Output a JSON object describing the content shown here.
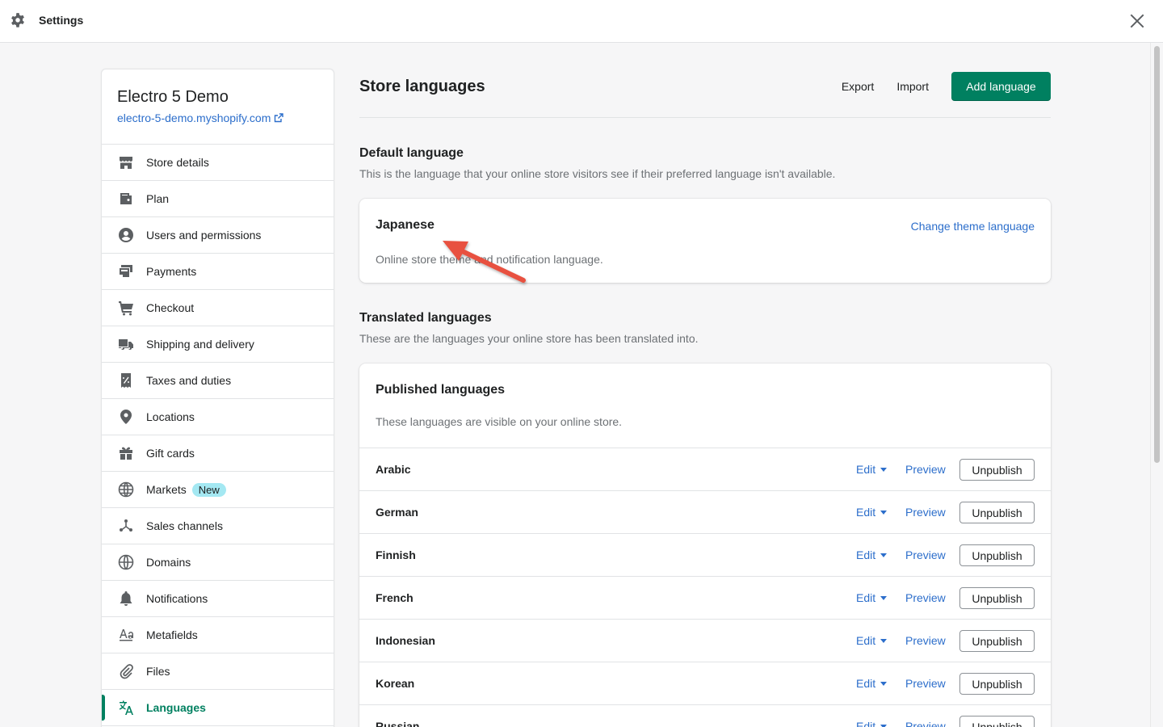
{
  "topbar": {
    "title": "Settings"
  },
  "store": {
    "name": "Electro 5 Demo",
    "url": "electro-5-demo.myshopify.com"
  },
  "sidebar": {
    "items": [
      {
        "label": "Store details",
        "icon": "store-icon"
      },
      {
        "label": "Plan",
        "icon": "wallet-icon"
      },
      {
        "label": "Users and permissions",
        "icon": "user-icon"
      },
      {
        "label": "Payments",
        "icon": "payment-icon"
      },
      {
        "label": "Checkout",
        "icon": "cart-icon"
      },
      {
        "label": "Shipping and delivery",
        "icon": "truck-icon"
      },
      {
        "label": "Taxes and duties",
        "icon": "tax-icon"
      },
      {
        "label": "Locations",
        "icon": "location-icon"
      },
      {
        "label": "Gift cards",
        "icon": "gift-icon"
      },
      {
        "label": "Markets",
        "icon": "globe-icon",
        "badge": "New"
      },
      {
        "label": "Sales channels",
        "icon": "channels-icon"
      },
      {
        "label": "Domains",
        "icon": "domain-icon"
      },
      {
        "label": "Notifications",
        "icon": "bell-icon"
      },
      {
        "label": "Metafields",
        "icon": "metafields-icon"
      },
      {
        "label": "Files",
        "icon": "paperclip-icon"
      },
      {
        "label": "Languages",
        "icon": "translate-icon",
        "active": true
      }
    ]
  },
  "page": {
    "title": "Store languages",
    "export_label": "Export",
    "import_label": "Import",
    "add_label": "Add language"
  },
  "default_language": {
    "title": "Default language",
    "description": "This is the language that your online store visitors see if their preferred language isn't available.",
    "language": "Japanese",
    "change_label": "Change theme language",
    "note": "Online store theme and notification language."
  },
  "translated": {
    "title": "Translated languages",
    "description": "These are the languages your online store has been translated into.",
    "published_title": "Published languages",
    "published_description": "These languages are visible on your online store.",
    "edit_label": "Edit",
    "preview_label": "Preview",
    "unpublish_label": "Unpublish",
    "languages": [
      "Arabic",
      "German",
      "Finnish",
      "French",
      "Indonesian",
      "Korean",
      "Russian"
    ]
  },
  "colors": {
    "accent": "#008060",
    "link": "#2c6ecb",
    "annotation_arrow": "#e8513f"
  }
}
